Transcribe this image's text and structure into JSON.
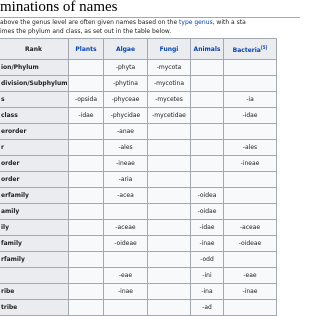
{
  "section": {
    "heading": "minations of names",
    "intro_line1_before": "above the genus level are often given names based on the ",
    "intro_link": "type genus",
    "intro_line1_after": ", with a sta",
    "intro_line2": "imes the phylum and class, as set out in the table below."
  },
  "table": {
    "headers": {
      "rank": "Rank",
      "plants": "Plants",
      "algae": "Algae",
      "fungi": "Fungi",
      "animals": "Animals",
      "bacteria": "Bacteria",
      "bacteria_note": "[5]"
    },
    "rows": [
      {
        "rank": "ion/Phylum",
        "plants": "",
        "algae": "-phyta",
        "fungi": "-mycota",
        "animals": "",
        "bacteria": ""
      },
      {
        "rank": "division/Subphylum",
        "plants": "",
        "algae": "-phytina",
        "fungi": "-mycotina",
        "animals": "",
        "bacteria": ""
      },
      {
        "rank": "s",
        "plants": "-opsida",
        "algae": "-phyceae",
        "fungi": "-mycetes",
        "animals": "",
        "bacteria": "-ia"
      },
      {
        "rank": "class",
        "plants": "-idae",
        "algae": "-phycidae",
        "fungi": "-mycetidae",
        "animals": "",
        "bacteria": "-idae"
      },
      {
        "rank": "erorder",
        "plants": "",
        "algae": "-anae",
        "fungi": "",
        "animals": "",
        "bacteria": ""
      },
      {
        "rank": "r",
        "plants": "",
        "algae": "-ales",
        "fungi": "",
        "animals": "",
        "bacteria": "-ales"
      },
      {
        "rank": "order",
        "plants": "",
        "algae": "-ineae",
        "fungi": "",
        "animals": "",
        "bacteria": "-ineae"
      },
      {
        "rank": "order",
        "plants": "",
        "algae": "-aria",
        "fungi": "",
        "animals": "",
        "bacteria": ""
      },
      {
        "rank": "erfamily",
        "plants": "",
        "algae": "-acea",
        "fungi": "",
        "animals": "-oidea",
        "bacteria": ""
      },
      {
        "rank": "amily",
        "plants": "",
        "algae": "",
        "fungi": "",
        "animals": "-oidae",
        "bacteria": ""
      },
      {
        "rank": "ily",
        "plants": "",
        "algae": "-aceae",
        "fungi": "",
        "animals": "-idae",
        "bacteria": "-aceae"
      },
      {
        "rank": "family",
        "plants": "",
        "algae": "-oideae",
        "fungi": "",
        "animals": "-inae",
        "bacteria": "-oideae"
      },
      {
        "rank": "rfamily",
        "plants": "",
        "algae": "",
        "fungi": "",
        "animals": "-odd",
        "bacteria": ""
      },
      {
        "rank": "",
        "plants": "",
        "algae": "-eae",
        "fungi": "",
        "animals": "-ini",
        "bacteria": "-eae"
      },
      {
        "rank": "ribe",
        "plants": "",
        "algae": "-inae",
        "fungi": "",
        "animals": "-ina",
        "bacteria": "-inae"
      },
      {
        "rank": "tribe",
        "plants": "",
        "algae": "",
        "fungi": "",
        "animals": "-ad",
        "bacteria": ""
      }
    ]
  },
  "colors": {
    "link": "#0645ad",
    "header_bg": "#eaecf0",
    "cell_bg": "#f8f9fa",
    "border": "#a2a9b1"
  }
}
